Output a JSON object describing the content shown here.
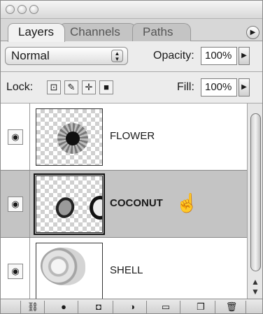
{
  "tabs": [
    {
      "label": "Layers",
      "active": true
    },
    {
      "label": "Channels",
      "active": false
    },
    {
      "label": "Paths",
      "active": false
    }
  ],
  "blend_mode": {
    "value": "Normal"
  },
  "opacity": {
    "label": "Opacity:",
    "value": "100%"
  },
  "lock": {
    "label": "Lock:",
    "icons": [
      "transparency-lock-icon",
      "brush-lock-icon",
      "move-lock-icon",
      "padlock-icon"
    ]
  },
  "fill": {
    "label": "Fill:",
    "value": "100%"
  },
  "layers": [
    {
      "name": "FLOWER",
      "selected": false,
      "visible": true
    },
    {
      "name": "COCONUT",
      "selected": true,
      "visible": true
    },
    {
      "name": "SHELL",
      "selected": false,
      "visible": true
    }
  ],
  "bottom_toolbar": [
    "link-icon",
    "layer-style-icon",
    "mask-icon",
    "adjustment-icon",
    "folder-icon",
    "new-layer-icon",
    "trash-icon"
  ],
  "colors": {
    "selected_row": "#c4c4c4",
    "panel": "#e4e4e4"
  }
}
